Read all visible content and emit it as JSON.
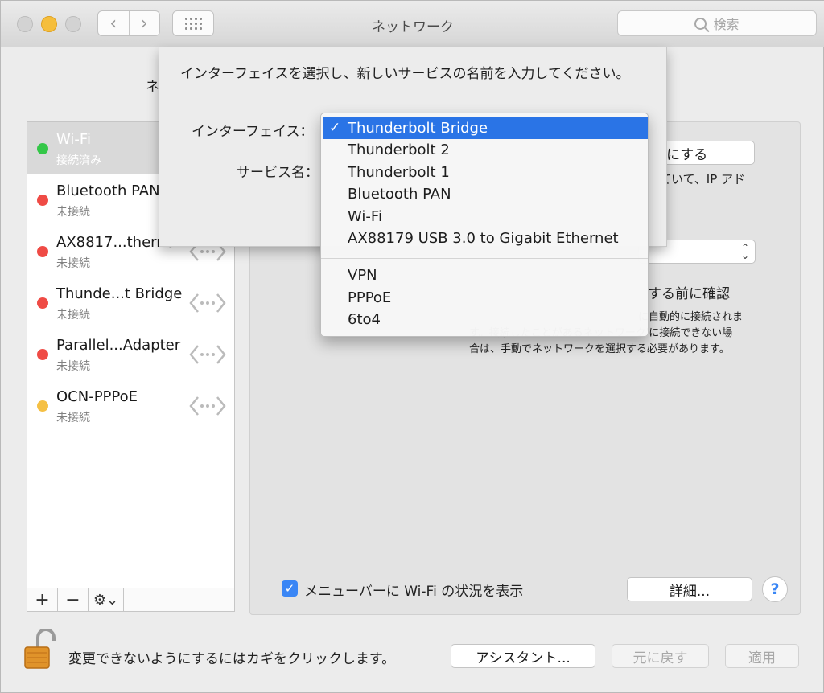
{
  "window": {
    "title": "ネットワーク",
    "search_placeholder": "検索"
  },
  "location_label_partial": "ネ",
  "sidebar": {
    "services": [
      {
        "name": "Wi-Fi",
        "status": "接続済み",
        "status_color": "#34c748",
        "selected": true
      },
      {
        "name": "Bluetooth PAN",
        "status": "未接続",
        "status_color": "#ef4b45",
        "selected": false
      },
      {
        "name": "AX8817...therne",
        "status": "未接続",
        "status_color": "#ef4b45",
        "selected": false
      },
      {
        "name": "Thunde...t Bridge",
        "status": "未接続",
        "status_color": "#ef4b45",
        "selected": false
      },
      {
        "name": "Parallel...Adapter",
        "status": "未接続",
        "status_color": "#ef4b45",
        "selected": false
      },
      {
        "name": "OCN-PPPoE",
        "status": "未接続",
        "status_color": "#f5c044",
        "selected": false
      }
    ],
    "toolbar": {
      "add": "+",
      "remove": "−",
      "gear": "⚙⌄"
    }
  },
  "panel": {
    "wifi_off_partial": "-切にする",
    "ip_text_partial_1": "ていて、IP アド",
    "ip_text_partial_2": "。",
    "confirm_partial": "する前に確認",
    "confirm_desc_line1": "に自動的に接続されま",
    "confirm_desc_line2": "す。接続したことがあるネットワーク'に接続できない場",
    "confirm_desc_line3": "合は、手動でネットワークを選択する必要があります。",
    "show_wifi_status_label": "メニューバーに Wi-Fi の状況を表示",
    "show_wifi_status_checked": true,
    "advanced_label": "詳細...",
    "help_label": "?"
  },
  "bottom": {
    "lock_text": "変更できないようにするにはカギをクリックします。",
    "assistant_label": "アシスタント...",
    "revert_label": "元に戻す",
    "apply_label": "適用"
  },
  "sheet": {
    "prompt": "インターフェイスを選択し、新しいサービスの名前を入力してください。",
    "interface_label": "インターフェイス：",
    "service_name_label": "サービス名："
  },
  "menu": {
    "items": [
      {
        "label": "Thunderbolt Bridge",
        "selected": true
      },
      {
        "label": "Thunderbolt 2"
      },
      {
        "label": "Thunderbolt 1"
      },
      {
        "label": "Bluetooth PAN"
      },
      {
        "label": "Wi-Fi"
      },
      {
        "label": "AX88179 USB 3.0 to Gigabit Ethernet"
      },
      {
        "label": "VPN"
      },
      {
        "label": "PPPoE"
      },
      {
        "label": "6to4"
      }
    ],
    "check_glyph": "✓"
  },
  "colors": {
    "accent": "#2a74e6",
    "connected": "#34c748",
    "disconnected": "#ef4b45",
    "pending": "#f5c044"
  }
}
